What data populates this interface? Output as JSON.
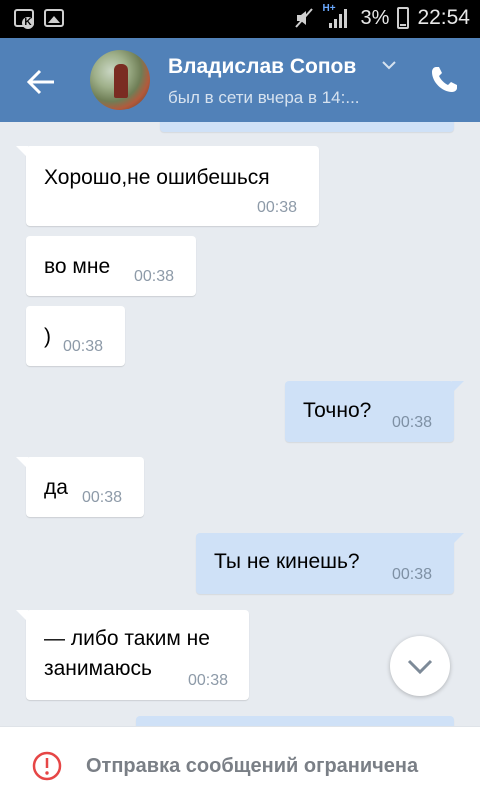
{
  "status_bar": {
    "network": "H+",
    "battery": "3%",
    "time": "22:54"
  },
  "header": {
    "name": "Владислав Сопов",
    "status": "был в сети вчера в 14:..."
  },
  "messages": [
    {
      "dir": "in",
      "text": "Хорошо,не ошибешься",
      "time": "00:38"
    },
    {
      "dir": "in",
      "text": "во мне",
      "time": "00:38"
    },
    {
      "dir": "in",
      "text": ")",
      "time": "00:38"
    },
    {
      "dir": "out",
      "text": "Точно?",
      "time": "00:38"
    },
    {
      "dir": "in",
      "text": "да",
      "time": "00:38"
    },
    {
      "dir": "out",
      "text": "Ты не кинешь?",
      "time": "00:38"
    },
    {
      "dir": "in",
      "text_line1": "— либо таким не",
      "text_line2": "занимаюсь",
      "time": "00:38"
    }
  ],
  "footer": {
    "notice": "Отправка сообщений ограничена"
  },
  "colors": {
    "header_bg": "#5181b8",
    "chat_bg": "#e7ebf0",
    "outgoing_bubble": "#cfe1f7",
    "warning_red": "#e64646"
  }
}
